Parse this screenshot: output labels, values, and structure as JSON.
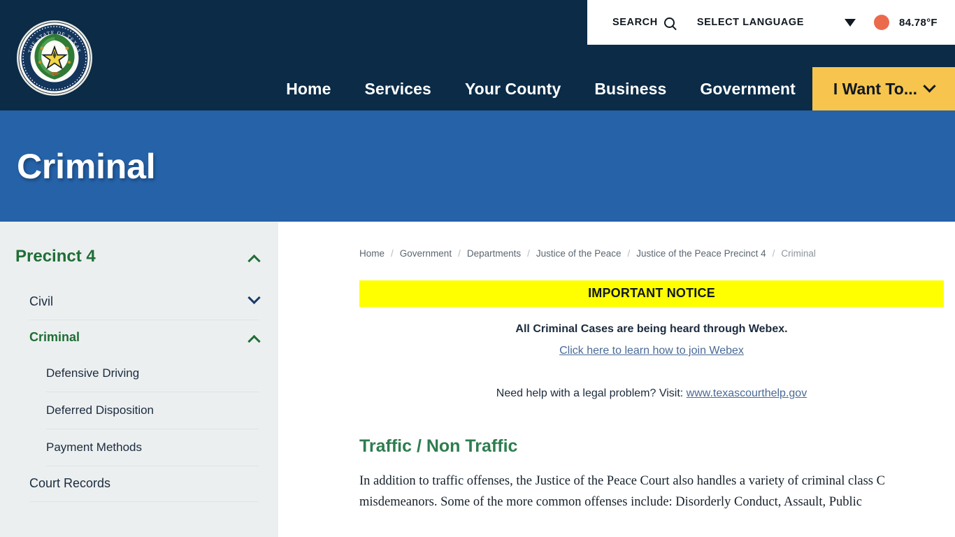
{
  "header": {
    "seal": {
      "name": "fort-bend-county-seal",
      "outer_text_top": "THE STATE OF TEXAS",
      "outer_text_bottom": "FORT BEND COUNTY"
    },
    "utility": {
      "search_label": "SEARCH",
      "search_icon": "search-icon",
      "language_label": "SELECT LANGUAGE",
      "language_caret_icon": "caret-down-icon",
      "weather_icon": "weather-dot-icon",
      "weather_color": "#ec6a4c",
      "temperature": "84.78°F"
    },
    "nav": {
      "items": [
        {
          "label": "Home"
        },
        {
          "label": "Services"
        },
        {
          "label": "Your County"
        },
        {
          "label": "Business"
        },
        {
          "label": "Government"
        }
      ],
      "cta": {
        "label": "I Want To...",
        "icon": "chevron-down-icon",
        "color": "#f7c54d"
      }
    },
    "colors": {
      "bar": "#0b2b47",
      "banner": "#2562a8"
    }
  },
  "banner": {
    "title": "Criminal"
  },
  "sidebar": {
    "heading": {
      "label": "Precinct 4",
      "icon": "chevron-up-icon",
      "expanded": true
    },
    "items": [
      {
        "label": "Civil",
        "icon": "chevron-down-icon",
        "expanded": false,
        "active": false
      },
      {
        "label": "Criminal",
        "icon": "chevron-up-icon",
        "expanded": true,
        "active": true
      }
    ],
    "sub_items": [
      {
        "label": "Defensive Driving"
      },
      {
        "label": "Deferred Disposition"
      },
      {
        "label": "Payment Methods"
      }
    ],
    "items_after": [
      {
        "label": "Court Records"
      }
    ],
    "colors": {
      "background": "#eceff0",
      "active": "#1f6e36",
      "text": "#1b2b3d"
    }
  },
  "content": {
    "breadcrumb": [
      {
        "label": "Home",
        "current": false
      },
      {
        "label": "Government",
        "current": false
      },
      {
        "label": "Departments",
        "current": false
      },
      {
        "label": "Justice of the Peace",
        "current": false
      },
      {
        "label": "Justice of the Peace Precinct 4",
        "current": false
      },
      {
        "label": "Criminal",
        "current": true
      }
    ],
    "breadcrumb_separator": "/",
    "notice": {
      "banner_label": "IMPORTANT NOTICE",
      "banner_color": "#ffff00",
      "statement": "All Criminal Cases are being heard through Webex.",
      "link_label": "Click here to learn how to join Webex"
    },
    "legal_help": {
      "prefix": "Need help with a legal problem? Visit: ",
      "link_label": "www.texascourthelp.gov"
    },
    "section": {
      "title": "Traffic / Non Traffic",
      "title_color": "#2e7d4f",
      "paragraph": "In addition to traffic offenses, the Justice of the Peace Court also handles a variety of criminal class C misdemeanors. Some of the more common offenses include: Disorderly Conduct, Assault, Public"
    }
  }
}
